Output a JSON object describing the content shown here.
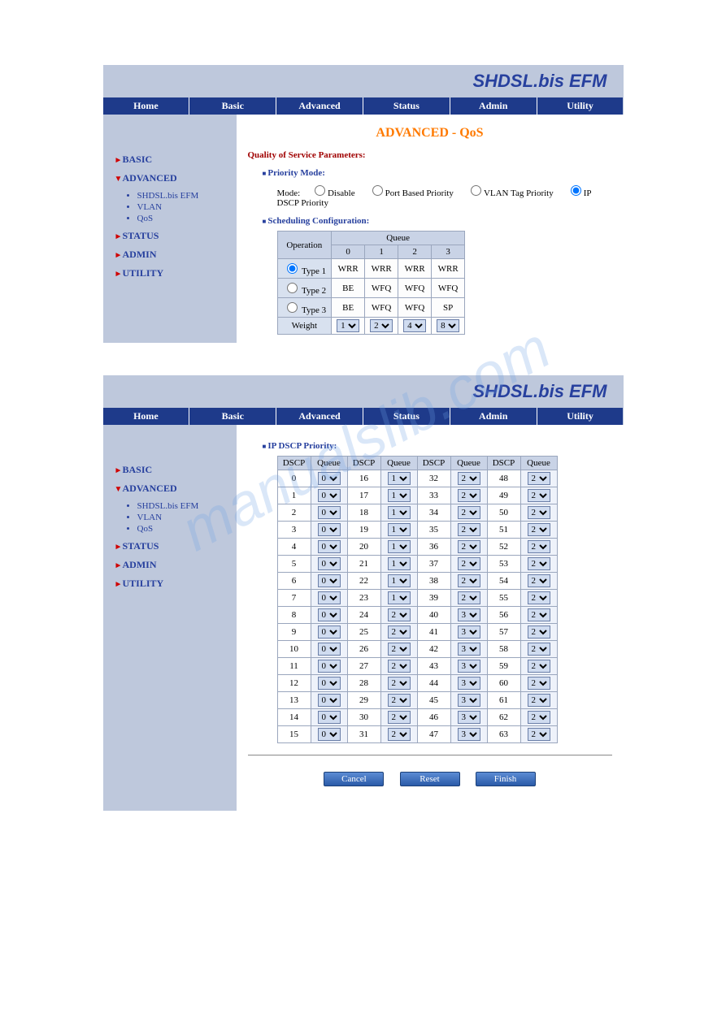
{
  "brand": "SHDSL.bis EFM",
  "watermark": "manualslib.com",
  "topnav": [
    "Home",
    "Basic",
    "Advanced",
    "Status",
    "Admin",
    "Utility"
  ],
  "sidebar": {
    "basic": "BASIC",
    "advanced": "ADVANCED",
    "adv_sub": [
      "SHDSL.bis EFM",
      "VLAN",
      "QoS"
    ],
    "status": "STATUS",
    "admin": "ADMIN",
    "utility": "UTILITY"
  },
  "page1": {
    "title": "ADVANCED - QoS",
    "h_qos": "Quality of Service Parameters:",
    "h_pmode": "Priority Mode:",
    "mode_label": "Mode:",
    "modes": [
      "Disable",
      "Port Based Priority",
      "VLAN Tag Priority",
      "IP DSCP Priority"
    ],
    "mode_selected": 3,
    "h_sched": "Scheduling Configuration:",
    "sched": {
      "op_header": "Operation",
      "queue_header": "Queue",
      "cols": [
        "0",
        "1",
        "2",
        "3"
      ],
      "rows": [
        {
          "label": "Type 1",
          "sel": true,
          "vals": [
            "WRR",
            "WRR",
            "WRR",
            "WRR"
          ]
        },
        {
          "label": "Type 2",
          "sel": false,
          "vals": [
            "BE",
            "WFQ",
            "WFQ",
            "WFQ"
          ]
        },
        {
          "label": "Type 3",
          "sel": false,
          "vals": [
            "BE",
            "WFQ",
            "WFQ",
            "SP"
          ]
        }
      ],
      "weight_label": "Weight",
      "weights": [
        "1",
        "2",
        "4",
        "8"
      ]
    }
  },
  "page2": {
    "h_dscp": "IP DSCP Priority:",
    "col_dscp": "DSCP",
    "col_queue": "Queue",
    "rows": [
      [
        {
          "d": 0,
          "q": "0"
        },
        {
          "d": 16,
          "q": "1"
        },
        {
          "d": 32,
          "q": "2"
        },
        {
          "d": 48,
          "q": "2"
        }
      ],
      [
        {
          "d": 1,
          "q": "0"
        },
        {
          "d": 17,
          "q": "1"
        },
        {
          "d": 33,
          "q": "2"
        },
        {
          "d": 49,
          "q": "2"
        }
      ],
      [
        {
          "d": 2,
          "q": "0"
        },
        {
          "d": 18,
          "q": "1"
        },
        {
          "d": 34,
          "q": "2"
        },
        {
          "d": 50,
          "q": "2"
        }
      ],
      [
        {
          "d": 3,
          "q": "0"
        },
        {
          "d": 19,
          "q": "1"
        },
        {
          "d": 35,
          "q": "2"
        },
        {
          "d": 51,
          "q": "2"
        }
      ],
      [
        {
          "d": 4,
          "q": "0"
        },
        {
          "d": 20,
          "q": "1"
        },
        {
          "d": 36,
          "q": "2"
        },
        {
          "d": 52,
          "q": "2"
        }
      ],
      [
        {
          "d": 5,
          "q": "0"
        },
        {
          "d": 21,
          "q": "1"
        },
        {
          "d": 37,
          "q": "2"
        },
        {
          "d": 53,
          "q": "2"
        }
      ],
      [
        {
          "d": 6,
          "q": "0"
        },
        {
          "d": 22,
          "q": "1"
        },
        {
          "d": 38,
          "q": "2"
        },
        {
          "d": 54,
          "q": "2"
        }
      ],
      [
        {
          "d": 7,
          "q": "0"
        },
        {
          "d": 23,
          "q": "1"
        },
        {
          "d": 39,
          "q": "2"
        },
        {
          "d": 55,
          "q": "2"
        }
      ],
      [
        {
          "d": 8,
          "q": "0"
        },
        {
          "d": 24,
          "q": "2"
        },
        {
          "d": 40,
          "q": "3"
        },
        {
          "d": 56,
          "q": "2"
        }
      ],
      [
        {
          "d": 9,
          "q": "0"
        },
        {
          "d": 25,
          "q": "2"
        },
        {
          "d": 41,
          "q": "3"
        },
        {
          "d": 57,
          "q": "2"
        }
      ],
      [
        {
          "d": 10,
          "q": "0"
        },
        {
          "d": 26,
          "q": "2"
        },
        {
          "d": 42,
          "q": "3"
        },
        {
          "d": 58,
          "q": "2"
        }
      ],
      [
        {
          "d": 11,
          "q": "0"
        },
        {
          "d": 27,
          "q": "2"
        },
        {
          "d": 43,
          "q": "3"
        },
        {
          "d": 59,
          "q": "2"
        }
      ],
      [
        {
          "d": 12,
          "q": "0"
        },
        {
          "d": 28,
          "q": "2"
        },
        {
          "d": 44,
          "q": "3"
        },
        {
          "d": 60,
          "q": "2"
        }
      ],
      [
        {
          "d": 13,
          "q": "0"
        },
        {
          "d": 29,
          "q": "2"
        },
        {
          "d": 45,
          "q": "3"
        },
        {
          "d": 61,
          "q": "2"
        }
      ],
      [
        {
          "d": 14,
          "q": "0"
        },
        {
          "d": 30,
          "q": "2"
        },
        {
          "d": 46,
          "q": "3"
        },
        {
          "d": 62,
          "q": "2"
        }
      ],
      [
        {
          "d": 15,
          "q": "0"
        },
        {
          "d": 31,
          "q": "2"
        },
        {
          "d": 47,
          "q": "3"
        },
        {
          "d": 63,
          "q": "2"
        }
      ]
    ],
    "buttons": {
      "cancel": "Cancel",
      "reset": "Reset",
      "finish": "Finish"
    }
  }
}
